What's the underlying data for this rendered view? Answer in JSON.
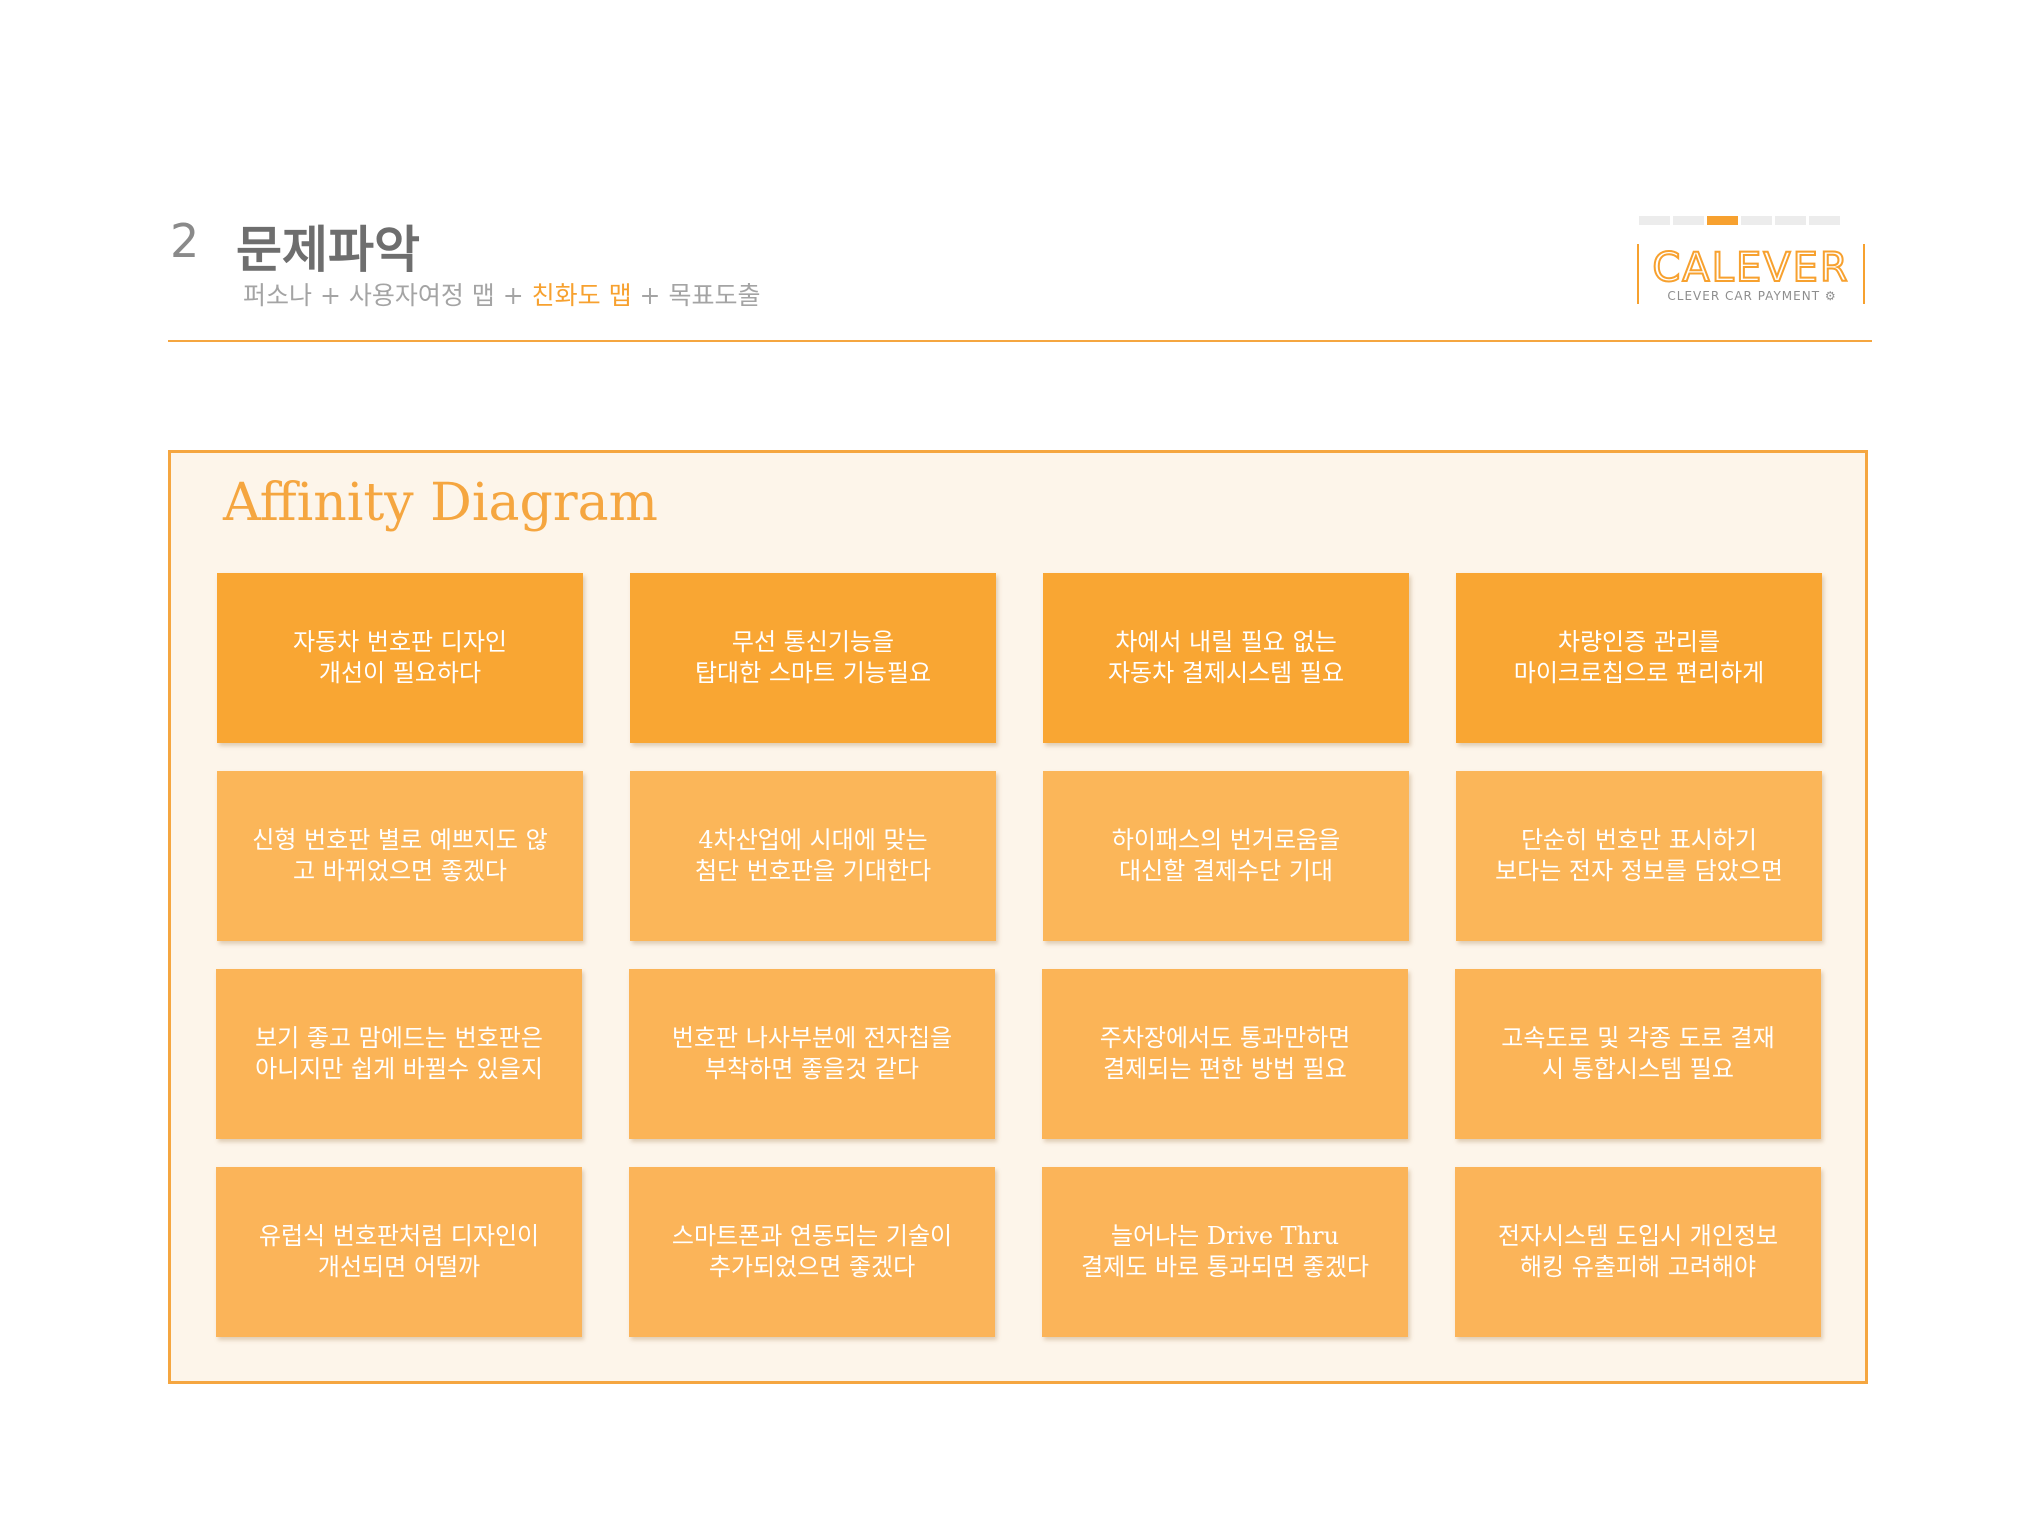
{
  "header": {
    "section_number": "2",
    "section_title": "문제파악",
    "breadcrumb": [
      {
        "label": "퍼소나",
        "active": false
      },
      {
        "label": "사용자여정 맵",
        "active": false
      },
      {
        "label": "친화도 맵",
        "active": true
      },
      {
        "label": "목표도출",
        "active": false
      }
    ],
    "separator": " + "
  },
  "logo": {
    "wordmark": "CALEVER",
    "tagline": "CLEVER CAR PAYMENT",
    "progress_total": 6,
    "progress_active": 3
  },
  "panel": {
    "title": "Affinity Diagram",
    "rows": [
      [
        "자동차 번호판 디자인\n개선이 필요하다",
        "무선 통신기능을\n탑대한 스마트 기능필요",
        "차에서 내릴 필요 없는\n자동차 결제시스템 필요",
        "차량인증 관리를\n마이크로칩으로 편리하게"
      ],
      [
        "신형 번호판 별로 예쁘지도 않\n고 바뀌었으면 좋겠다",
        "4차산업에 시대에  맞는\n첨단 번호판을 기대한다",
        "하이패스의 번거로움을\n대신할 결제수단 기대",
        "단순히 번호만 표시하기\n보다는 전자 정보를 담았으면"
      ],
      [
        "보기 좋고 맘에드는 번호판은\n아니지만 쉽게 바뀔수 있을지",
        "번호판 나사부분에 전자칩을\n부착하면 좋을것 같다",
        "주차장에서도 통과만하면\n결제되는 편한 방법 필요",
        "고속도로 및 각종 도로 결재\n시 통합시스템 필요"
      ],
      [
        "유럽식 번호판처럼 디자인이\n개선되면 어떨까",
        "스마트폰과 연동되는 기술이\n추가되었으면 좋겠다",
        "늘어나는 Drive Thru\n결제도 바로 통과되면 좋겠다",
        "전자시스템 도입시 개인정보\n해킹 유출피해 고려해야"
      ]
    ]
  },
  "colors": {
    "accent": "#f5a640",
    "card_row1": "#f9a633",
    "card_rows": "#fbb459",
    "panel_bg": "#fdf5ea"
  }
}
